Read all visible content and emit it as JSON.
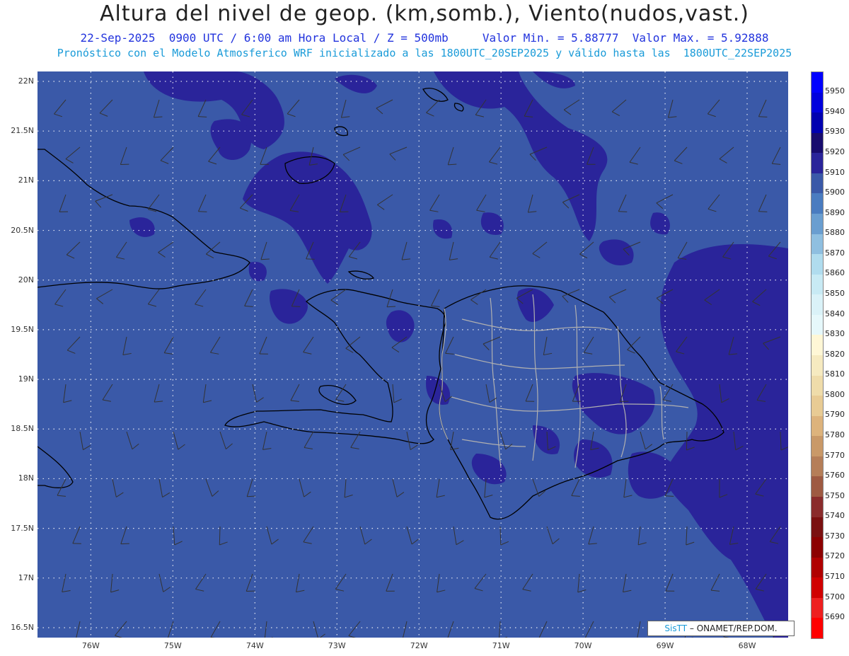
{
  "header": {
    "title": "Altura del nivel de geop. (km,somb.), Viento(nudos,vast.)",
    "subtitle_time": "22-Sep-2025  0900 UTC / 6:00 am Hora Local / Z = 500mb",
    "subtitle_range": "Valor Min. = 5.88777  Valor Max. = 5.92888",
    "model_info": "Pronóstico con el Modelo Atmosferico WRF inicializado a las 1800UTC_20SEP2025 y válido hasta las  1800UTC_22SEP2025"
  },
  "map": {
    "background_color": "#3a59a8",
    "high_color": "#2a249a",
    "lon_range": [
      -76.65,
      -67.5
    ],
    "lat_range": [
      16.4,
      22.1
    ],
    "lat_labels": [
      "22N",
      "21.5N",
      "21N",
      "20.5N",
      "20N",
      "19.5N",
      "19N",
      "18.5N",
      "18N",
      "17.5N",
      "17N",
      "16.5N"
    ],
    "lon_labels": [
      "76W",
      "75W",
      "74W",
      "73W",
      "72W",
      "71W",
      "70W",
      "69W",
      "68W"
    ]
  },
  "colorbar": {
    "levels": [
      5950,
      5940,
      5930,
      5920,
      5910,
      5900,
      5890,
      5880,
      5870,
      5860,
      5850,
      5840,
      5830,
      5820,
      5810,
      5800,
      5790,
      5780,
      5770,
      5760,
      5750,
      5740,
      5730,
      5720,
      5710,
      5700,
      5690
    ],
    "labels": [
      "5950",
      "5940",
      "5930",
      "5920",
      "5910",
      "5900",
      "5890",
      "5880",
      "5870",
      "5860",
      "5850",
      "5840",
      "5830",
      "5820",
      "5810",
      "5800",
      "5790",
      "5780",
      "5770",
      "5760",
      "5750",
      "5740",
      "5730",
      "5720",
      "5710",
      "5700",
      "5690"
    ],
    "colors": [
      "#0000ff",
      "#0000dd",
      "#0000b0",
      "#180c6e",
      "#2a249a",
      "#3a59a8",
      "#4a7cc0",
      "#6a9ed0",
      "#8fbfe0",
      "#b0dcee",
      "#c8eaf4",
      "#daf2f8",
      "#e6f8fb",
      "#fff7d6",
      "#f6eac0",
      "#efdcaa",
      "#e8cb94",
      "#ddb37c",
      "#c99968",
      "#b57e58",
      "#9e5a42",
      "#8a2c2c",
      "#7a1010",
      "#8c0000",
      "#b00000",
      "#d00000",
      "#ee2020"
    ],
    "bottom_color": "#ff0000"
  },
  "credit": {
    "brand": "SisTT",
    "text": " – ONAMET/REP.DOM."
  }
}
